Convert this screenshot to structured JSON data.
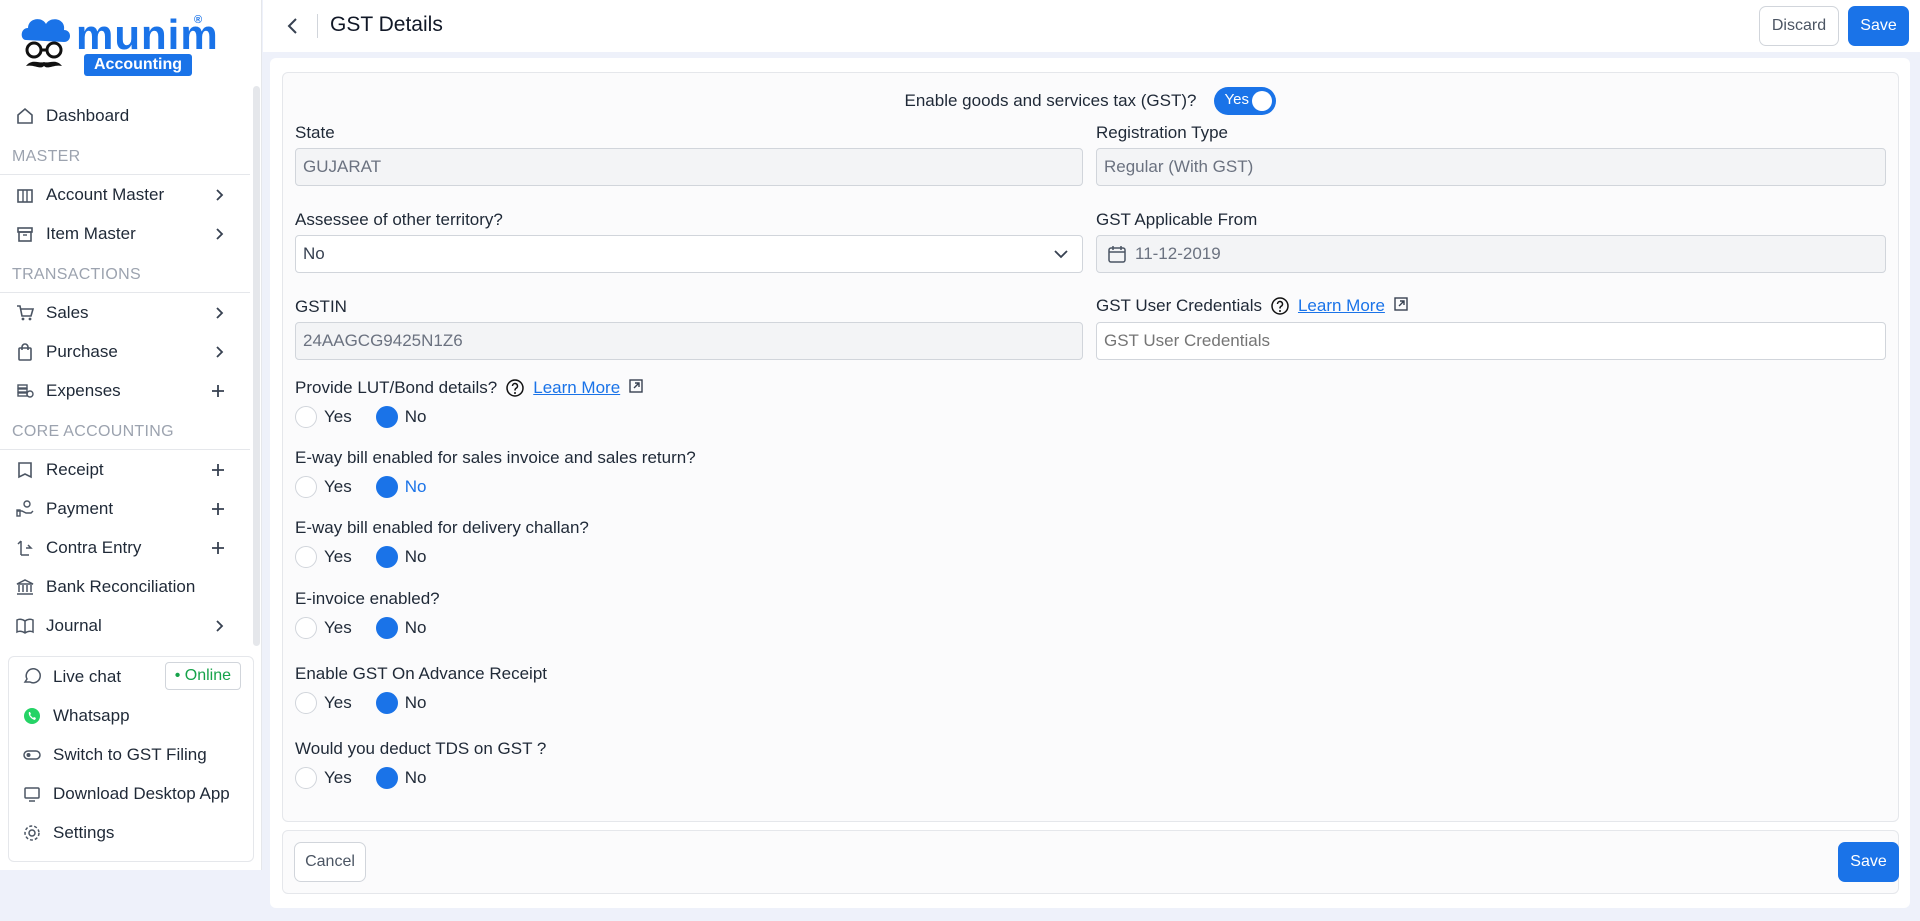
{
  "brand": {
    "name": "munim",
    "tag": "Accounting",
    "reg": "®"
  },
  "sidebar": {
    "items": [
      {
        "label": "Dashboard"
      },
      {
        "section": "MASTER"
      },
      {
        "label": "Account Master"
      },
      {
        "label": "Item Master"
      },
      {
        "section": "TRANSACTIONS"
      },
      {
        "label": "Sales"
      },
      {
        "label": "Purchase"
      },
      {
        "label": "Expenses"
      },
      {
        "section": "CORE ACCOUNTING"
      },
      {
        "label": "Receipt"
      },
      {
        "label": "Payment"
      },
      {
        "label": "Contra Entry"
      },
      {
        "label": "Bank Reconciliation"
      },
      {
        "label": "Journal"
      }
    ],
    "bottom": {
      "live_chat": "Live chat",
      "online": "• Online",
      "whatsapp": "Whatsapp",
      "gst_filing": "Switch to GST Filing",
      "download": "Download Desktop App",
      "settings": "Settings"
    }
  },
  "header": {
    "title": "GST Details",
    "discard": "Discard",
    "save": "Save"
  },
  "form": {
    "gst_question": "Enable goods and services tax (GST)?",
    "gst_toggle": "Yes",
    "state_label": "State",
    "state_value": "GUJARAT",
    "reg_type_label": "Registration Type",
    "reg_type_value": "Regular (With GST)",
    "assessee_label": "Assessee of other territory?",
    "assessee_value": "No",
    "applicable_label": "GST Applicable From",
    "applicable_value": "11-12-2019",
    "gstin_label": "GSTIN",
    "gstin_value": "24AAGCG9425N1Z6",
    "credentials_label": "GST User Credentials",
    "credentials_placeholder": "GST User Credentials",
    "learn_more": "Learn More",
    "yes": "Yes",
    "no": "No",
    "questions": {
      "lut": "Provide LUT/Bond details?",
      "eway_sales": "E-way bill enabled for sales invoice and sales return?",
      "eway_challan": "E-way bill enabled for delivery challan?",
      "einvoice": "E-invoice enabled?",
      "advance": "Enable GST On Advance Receipt",
      "tds": "Would you deduct TDS on GST ?"
    }
  },
  "footer": {
    "cancel": "Cancel",
    "save": "Save"
  },
  "colors": {
    "accent": "#1a73e8",
    "online": "#16a34a"
  }
}
